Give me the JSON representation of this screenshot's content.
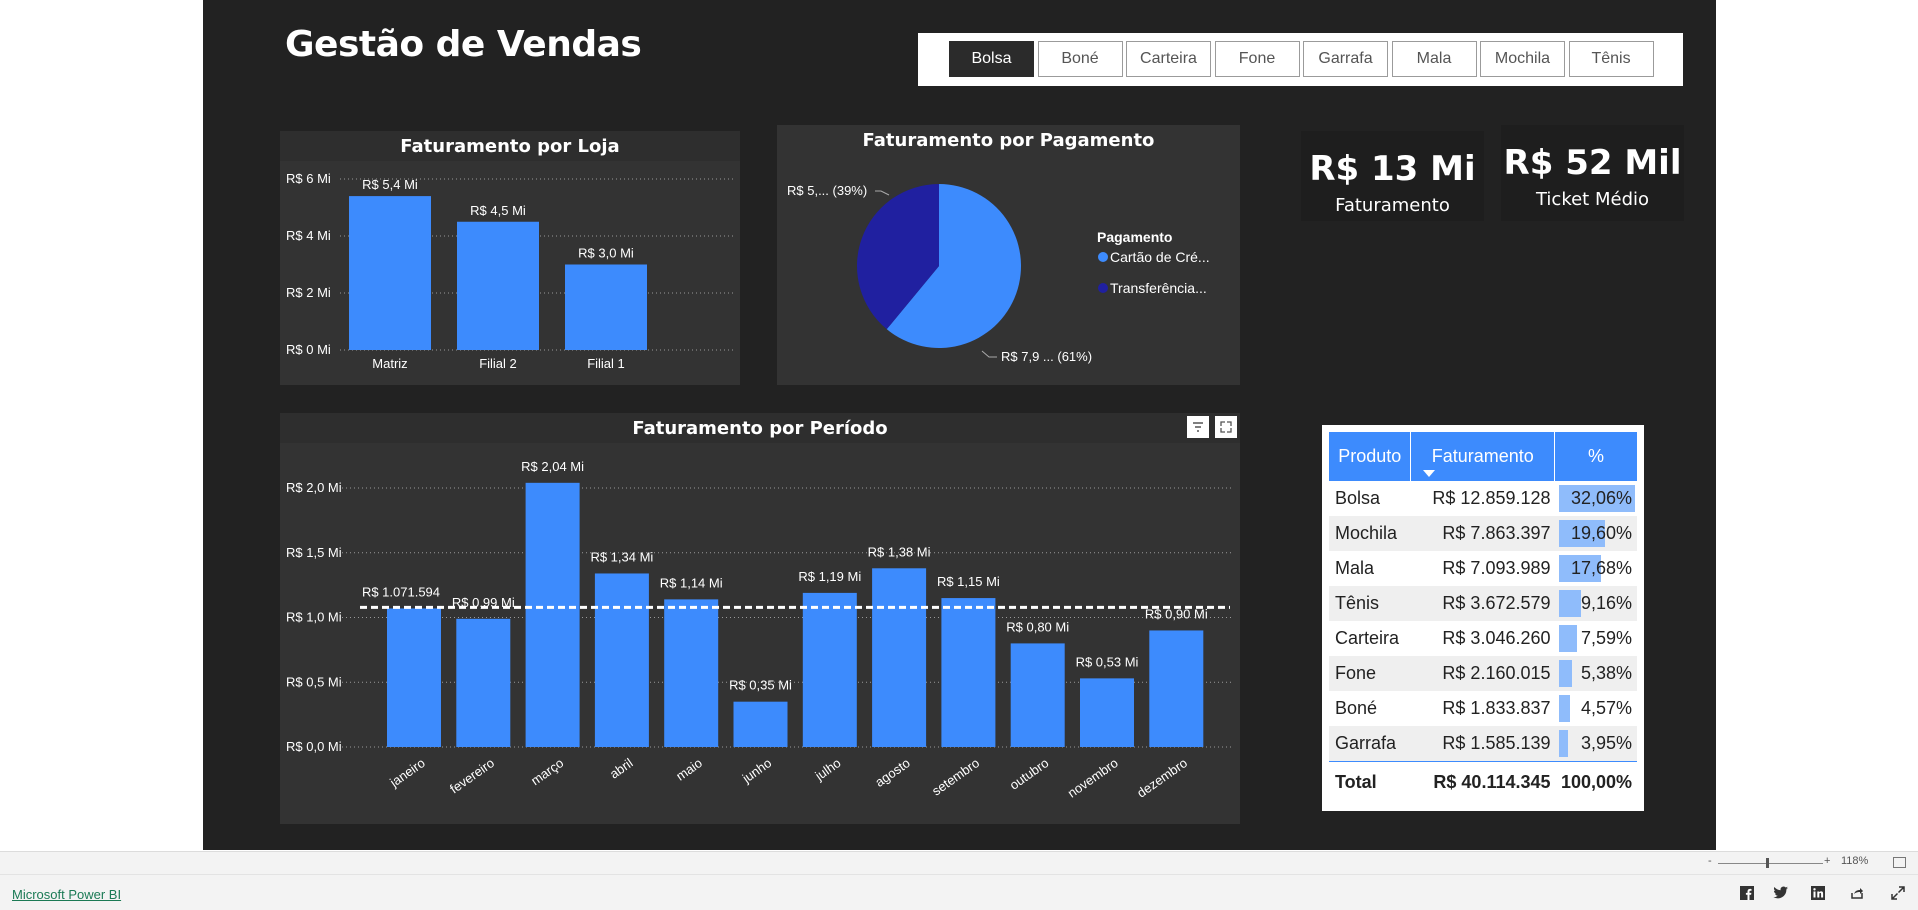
{
  "report": {
    "title": "Gestão de Vendas"
  },
  "slicer": {
    "options": [
      "Bolsa",
      "Boné",
      "Carteira",
      "Fone",
      "Garrafa",
      "Mala",
      "Mochila",
      "Tênis"
    ],
    "selected": "Bolsa"
  },
  "cards": {
    "faturamento": {
      "value": "R$ 13 Mi",
      "label": "Faturamento"
    },
    "ticket": {
      "value": "R$ 52 Mil",
      "label": "Ticket Médio"
    }
  },
  "panels": {
    "loja_title": "Faturamento por Loja",
    "pagamento_title": "Faturamento por Pagamento",
    "periodo_title": "Faturamento por Período"
  },
  "icons": [
    "filter-icon",
    "focus-mode-icon",
    "facebook-icon",
    "twitter-icon",
    "linkedin-icon",
    "share-icon",
    "fullscreen-icon",
    "fit-page-icon"
  ],
  "colors": {
    "bar": "#3d8bfd",
    "dark_blue": "#2020a0",
    "background": "#222222",
    "panel": "#333333"
  },
  "chart_data": [
    {
      "type": "bar",
      "title": "Faturamento por Loja",
      "categories": [
        "Matriz",
        "Filial 2",
        "Filial 1"
      ],
      "values": [
        5.4,
        4.5,
        3.0
      ],
      "data_labels": [
        "R$ 5,4 Mi",
        "R$ 4,5 Mi",
        "R$ 3,0 Mi"
      ],
      "ytick_labels": [
        "R$ 0 Mi",
        "R$ 2 Mi",
        "R$ 4 Mi",
        "R$ 6 Mi"
      ],
      "yticks": [
        0,
        2,
        4,
        6
      ],
      "ylim": [
        0,
        6
      ],
      "grid": true
    },
    {
      "type": "pie",
      "title": "Faturamento por Pagamento",
      "legend_title": "Pagamento",
      "legend_placement": "right",
      "slices": [
        {
          "name": "Cartão de Cré...",
          "value": 61,
          "label": "R$ 7,9 ... (61%)",
          "color": "#3d8bfd"
        },
        {
          "name": "Transferência...",
          "value": 39,
          "label": "R$ 5,... (39%)",
          "color": "#2020a0"
        }
      ]
    },
    {
      "type": "bar",
      "title": "Faturamento por Período",
      "categories": [
        "janeiro",
        "fevereiro",
        "março",
        "abril",
        "maio",
        "junho",
        "julho",
        "agosto",
        "setembro",
        "outubro",
        "novembro",
        "dezembro"
      ],
      "values": [
        1.07,
        0.99,
        2.04,
        1.34,
        1.14,
        0.35,
        1.19,
        1.38,
        1.15,
        0.8,
        0.53,
        0.9
      ],
      "data_labels": [
        "R$ 1.071.594",
        "R$ 0,99 Mi",
        "R$ 2,04 Mi",
        "R$ 1,34 Mi",
        "R$ 1,14 Mi",
        "R$ 0,35 Mi",
        "R$ 1,19 Mi",
        "R$ 1,38 Mi",
        "R$ 1,15 Mi",
        "R$ 0,80 Mi",
        "R$ 0,53 Mi",
        "R$ 0,90 Mi"
      ],
      "ytick_labels": [
        "R$ 0,0 Mi",
        "R$ 0,5 Mi",
        "R$ 1,0 Mi",
        "R$ 1,5 Mi",
        "R$ 2,0 Mi"
      ],
      "yticks": [
        0,
        0.5,
        1.0,
        1.5,
        2.0
      ],
      "ylim": [
        0,
        2.1
      ],
      "average_line": 1.07,
      "grid": true
    }
  ],
  "matrix": {
    "headers": [
      "Produto",
      "Faturamento",
      "%"
    ],
    "rows": [
      {
        "produto": "Bolsa",
        "faturamento": "R$ 12.859.128",
        "pct": "32,06%",
        "share": 0.3206
      },
      {
        "produto": "Mochila",
        "faturamento": "R$ 7.863.397",
        "pct": "19,60%",
        "share": 0.196
      },
      {
        "produto": "Mala",
        "faturamento": "R$ 7.093.989",
        "pct": "17,68%",
        "share": 0.1768
      },
      {
        "produto": "Tênis",
        "faturamento": "R$ 3.672.579",
        "pct": "9,16%",
        "share": 0.0916
      },
      {
        "produto": "Carteira",
        "faturamento": "R$ 3.046.260",
        "pct": "7,59%",
        "share": 0.0759
      },
      {
        "produto": "Fone",
        "faturamento": "R$ 2.160.015",
        "pct": "5,38%",
        "share": 0.0538
      },
      {
        "produto": "Boné",
        "faturamento": "R$ 1.833.837",
        "pct": "4,57%",
        "share": 0.0457
      },
      {
        "produto": "Garrafa",
        "faturamento": "R$ 1.585.139",
        "pct": "3,95%",
        "share": 0.0395
      }
    ],
    "total": {
      "label": "Total",
      "faturamento": "R$ 40.114.345",
      "pct": "100,00%"
    }
  },
  "statusbar": {
    "zoom": "118%",
    "zoom_out": "-",
    "zoom_in": "+"
  },
  "footer": {
    "link": "Microsoft Power BI"
  }
}
